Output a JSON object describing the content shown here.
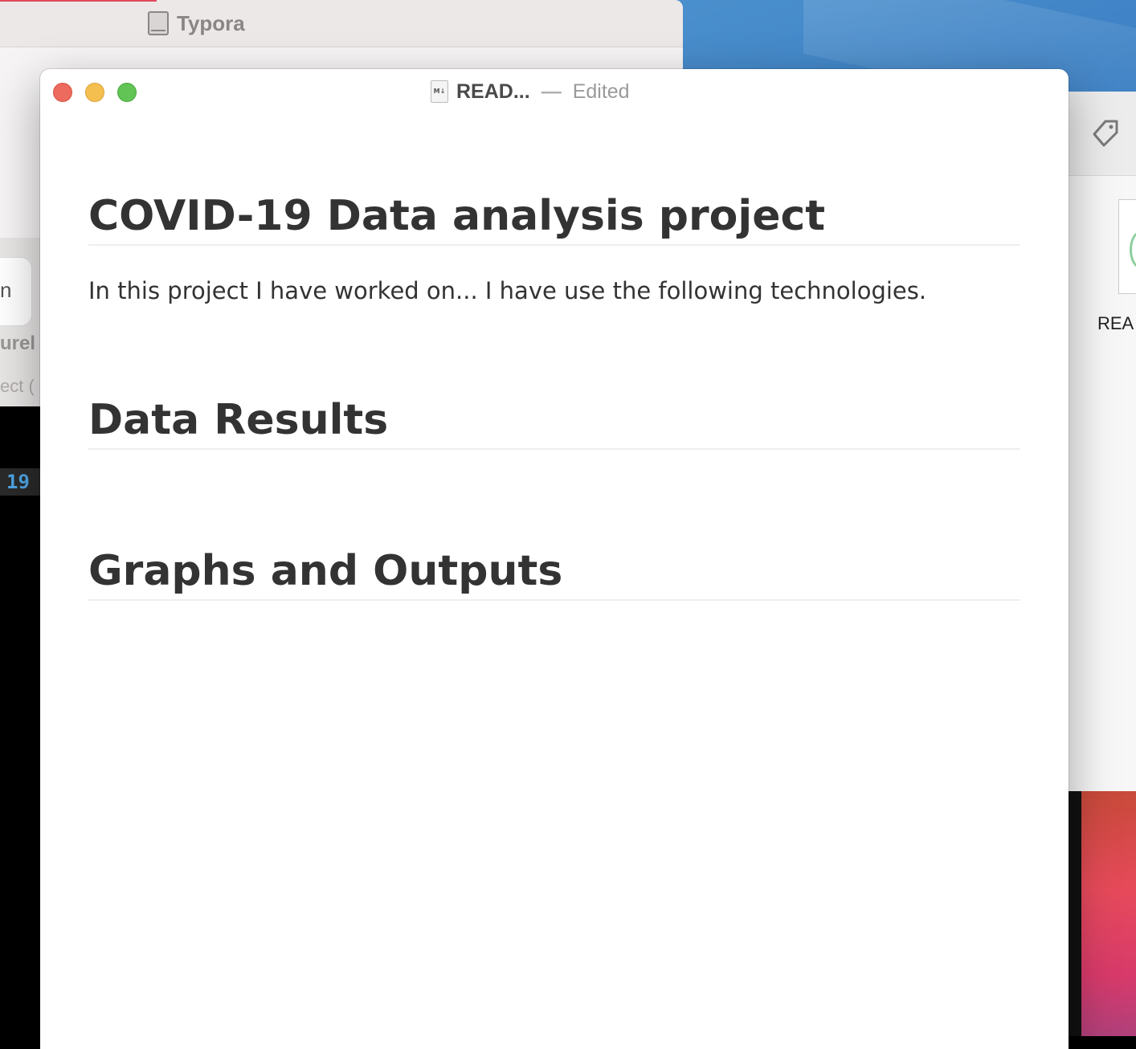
{
  "background_window": {
    "title": "Typora",
    "fragment_top": "n",
    "fragment_bold": "urel",
    "fragment_light": "ect ("
  },
  "terminal": {
    "badge_text": "19"
  },
  "right_window": {
    "file_label": "REA",
    "tag_icon": "tag-icon"
  },
  "main_window": {
    "doc_icon_label": "M↓",
    "doc_name": "READ...",
    "separator": "—",
    "status": "Edited"
  },
  "document": {
    "heading_1": "COVID-19 Data analysis project",
    "paragraph_1": "In this project I have worked on... I have use the following technologies.",
    "heading_2": "Data Results",
    "heading_3": "Graphs and Outputs"
  },
  "colors": {
    "close": "#ed6a5e",
    "minimize": "#f5bf4f",
    "maximize": "#61c454",
    "terminal_accent": "#4ea5e6"
  }
}
